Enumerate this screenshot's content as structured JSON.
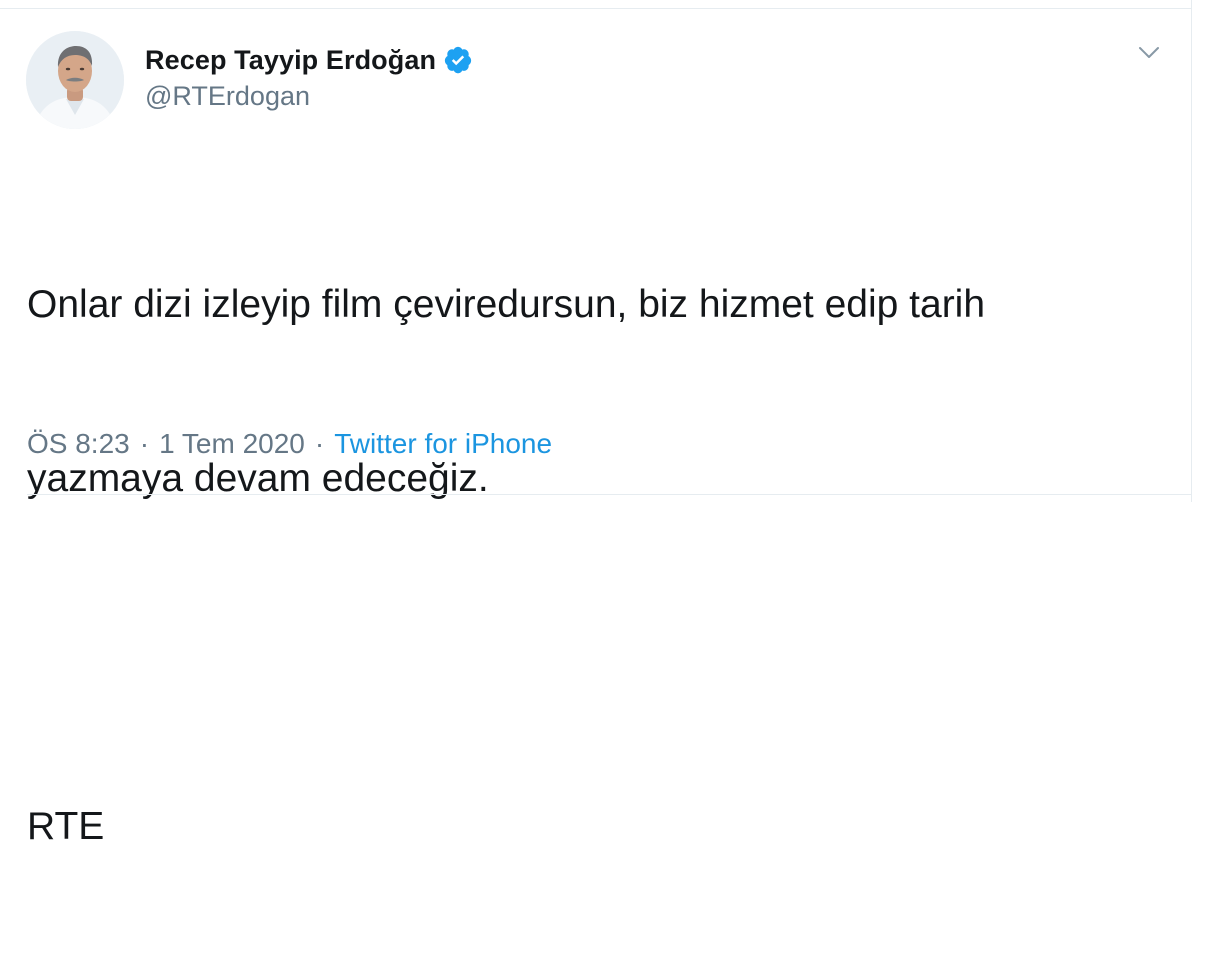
{
  "tweet": {
    "display_name": "Recep Tayyip Erdoğan",
    "verified": true,
    "handle": "@RTErdogan",
    "text_lines": [
      "Onlar dizi izleyip film çeviredursun, biz hizmet edip tarih",
      "yazmaya devam edeceğiz."
    ],
    "signature": "RTE",
    "time": "ÖS 8:23",
    "date": "1 Tem 2020",
    "separator": "·",
    "source": "Twitter for iPhone"
  },
  "colors": {
    "accent": "#1da1f2",
    "link": "#1b95e0",
    "text": "#14171a",
    "muted": "#657786",
    "divider": "#e6ecf0"
  },
  "icons": {
    "verified": "verified-badge-icon",
    "menu": "chevron-down-icon"
  }
}
